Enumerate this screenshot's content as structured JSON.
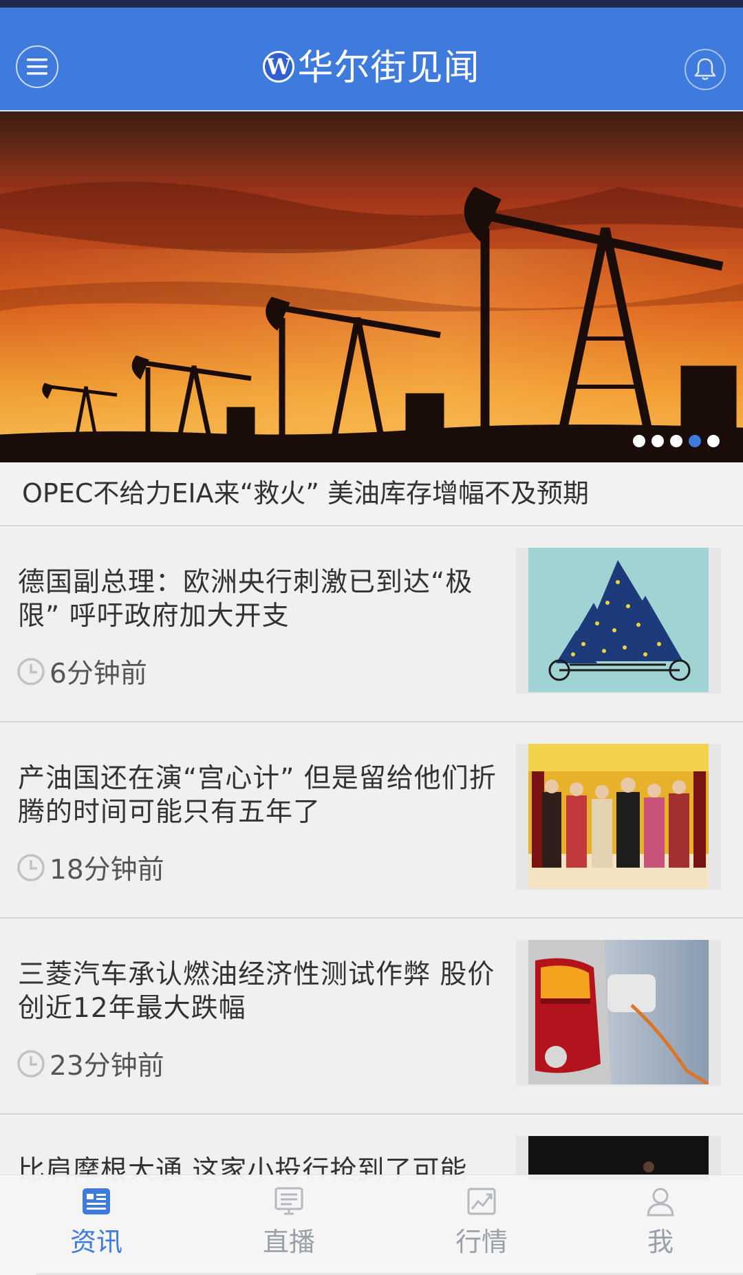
{
  "app": {
    "title": "华尔街见闻",
    "logo_letter": "W",
    "accent_color": "#3f7bdc",
    "icons": {
      "menu": "menu-icon",
      "notification": "bell-icon"
    }
  },
  "hero": {
    "caption": "OPEC不给力EIA来“救火” 美油库存增幅不及预期",
    "image": "oil-pumpjacks-sunset",
    "slide_count": 5,
    "active_slide": 4
  },
  "news": [
    {
      "title": "德国副总理：欧洲央行刺激已到达“极限” 呼吁政府加大开支",
      "time": "6分钟前",
      "thumbnail": "eu-cyclists-illustration"
    },
    {
      "title": "产油国还在演“宫心计” 但是留给他们折腾的时间可能只有五年了",
      "time": "18分钟前",
      "thumbnail": "palace-drama-cast"
    },
    {
      "title": " 三菱汽车承认燃油经济性测试作弊 股价创近12年最大跌幅",
      "time": "23分钟前",
      "thumbnail": "car-taillight-charger"
    },
    {
      "title": "比肩摩根大通 这家小投行抢到了可能",
      "time": "",
      "thumbnail": "dark-photo"
    }
  ],
  "tabs": [
    {
      "label": "资讯",
      "icon": "news-icon",
      "active": true
    },
    {
      "label": "直播",
      "icon": "live-icon",
      "active": false
    },
    {
      "label": "行情",
      "icon": "chart-icon",
      "active": false
    },
    {
      "label": "我",
      "icon": "profile-icon",
      "active": false
    }
  ]
}
